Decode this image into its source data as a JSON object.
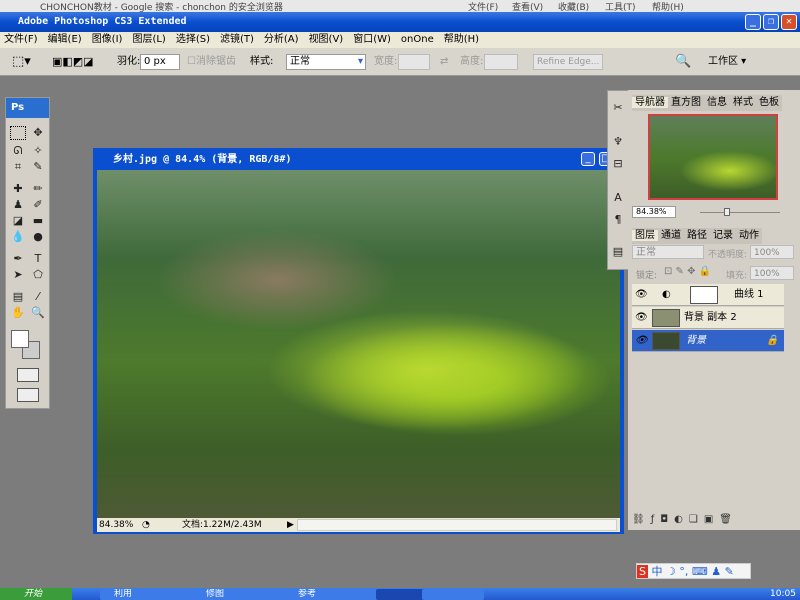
{
  "browser": {
    "title": "CHONCHON教材 - Google 搜索 - chonchon 的安全浏览器",
    "menus": [
      "文件(F)",
      "查看(V)",
      "收藏(B)",
      "工具(T)",
      "帮助(H)"
    ]
  },
  "app": {
    "title": "Adobe Photoshop CS3 Extended"
  },
  "menu": [
    "文件(F)",
    "编辑(E)",
    "图像(I)",
    "图层(L)",
    "选择(S)",
    "滤镜(T)",
    "分析(A)",
    "视图(V)",
    "窗口(W)",
    "onOne",
    "帮助(H)"
  ],
  "options": {
    "feather_label": "羽化:",
    "feather_value": "0 px",
    "antialias_label": "消除锯齿",
    "style_label": "样式:",
    "style_value": "正常",
    "width_label": "宽度:",
    "height_label": "高度:",
    "refine_edge": "Refine Edge...",
    "workspace": "工作区 ▾"
  },
  "toolbox": {
    "logo": "Ps"
  },
  "document": {
    "title": "乡村.jpg @ 84.4% (背景, RGB/8#)",
    "zoom": "84.38%",
    "doc_info": "文档:1.22M/2.43M"
  },
  "navigator": {
    "tabs": [
      "导航器",
      "直方图",
      "信息",
      "样式",
      "色板"
    ],
    "zoom": "84.38%"
  },
  "layers_panel": {
    "tabs": [
      "图层",
      "通道",
      "路径",
      "记录",
      "动作"
    ],
    "blend_mode": "正常",
    "opacity_label": "不透明度:",
    "opacity": "100%",
    "lock_label": "锁定:",
    "fill_label": "填充:",
    "fill": "100%",
    "layers": [
      {
        "name": "曲线 1",
        "selected": false
      },
      {
        "name": "背景 副本 2",
        "selected": false
      },
      {
        "name": "背景",
        "selected": true
      }
    ]
  },
  "taskbar": {
    "start": "开始",
    "tasks": [
      "利用",
      "",
      "修图",
      "",
      "参考",
      "",
      "",
      "",
      "",
      "e"
    ],
    "clock": "10:05"
  },
  "ime": {
    "label": "中"
  },
  "colors": {
    "titlebar": "#0a4fd0",
    "selection": "#3163c8",
    "workspace": "#7c7c7c"
  }
}
